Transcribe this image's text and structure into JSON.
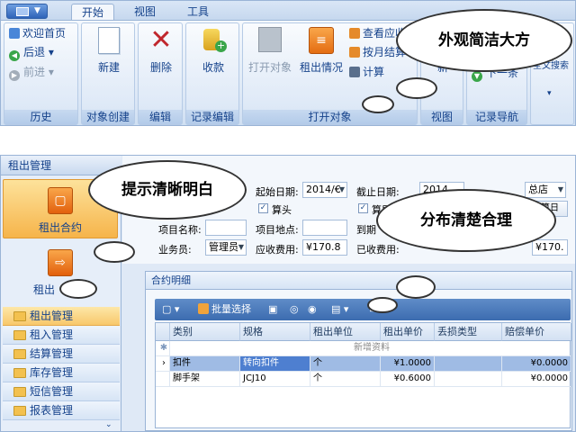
{
  "ribbon": {
    "tabs": [
      "开始",
      "视图",
      "工具"
    ],
    "groups": {
      "history": {
        "label": "历史",
        "items": [
          "欢迎首页",
          "后退",
          "前进"
        ]
      },
      "object_create": {
        "label": "对象创建",
        "new": "新建"
      },
      "edit": {
        "label": "编辑",
        "delete": "删除"
      },
      "record_edit": {
        "label": "记录编辑",
        "collect": "收款"
      },
      "open_object": {
        "label": "打开对象",
        "open": "打开对象",
        "rent": "租出情况",
        "items": [
          "查看应收",
          "按月结算",
          "计算"
        ]
      },
      "view": {
        "label": "视图",
        "refresh": "新"
      },
      "record_nav": {
        "label": "记录导航",
        "next": "下一条"
      },
      "fulltext": {
        "label": "全文搜索"
      }
    }
  },
  "bubbles": {
    "top": "外观简洁大方",
    "left": "提示清晰明白",
    "right": "分布清楚合理"
  },
  "nav": {
    "title": "租出管理",
    "tiles": [
      "租出合约",
      "租出"
    ],
    "items": [
      "租出管理",
      "租入管理",
      "结算管理",
      "库存管理",
      "短信管理",
      "报表管理"
    ]
  },
  "form": {
    "start_date_label": "起始日期:",
    "start_date": "2014/€",
    "end_date_label": "截止日期:",
    "end_date": "2014",
    "store": "总店",
    "check1": "算头",
    "check2": "算尾",
    "settle_btn": "算日",
    "project_name_label": "项目名称:",
    "project_location_label": "项目地点:",
    "due_label": "到期",
    "salesperson_label": "业务员:",
    "salesperson": "管理员",
    "receivable_label": "应收费用:",
    "receivable": "¥170.8",
    "received_label": "已收费用:",
    "received": "¥170."
  },
  "detail": {
    "title": "合约明细",
    "toolbar": {
      "batch_select": "批量选择"
    },
    "columns": [
      "类别",
      "规格",
      "租出单位",
      "租出单价",
      "丢损类型",
      "赔偿单价"
    ],
    "new_row": "新增资料",
    "rows": [
      {
        "category": "扣件",
        "spec": "转向扣件",
        "unit": "个",
        "price": "¥1.0000",
        "loss": "",
        "comp": "¥0.0000"
      },
      {
        "category": "脚手架",
        "spec": "JCJ10",
        "unit": "个",
        "price": "¥0.6000",
        "loss": "",
        "comp": "¥0.0000"
      }
    ]
  }
}
